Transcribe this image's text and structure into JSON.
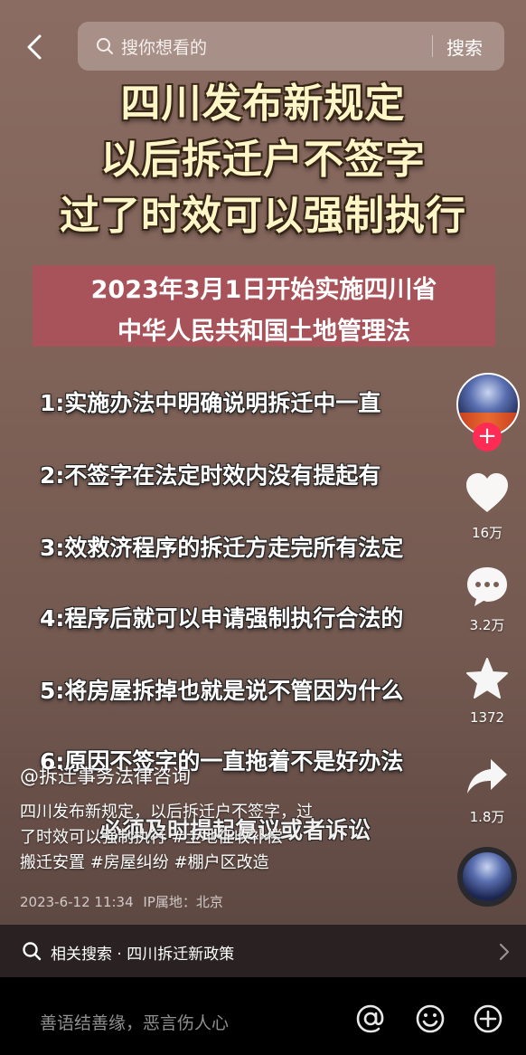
{
  "search": {
    "placeholder": "搜你想看的",
    "submit_label": "搜索"
  },
  "video": {
    "headline": [
      "四川发布新规定",
      "以后拆迁户不签字",
      "过了时效可以强制执行"
    ],
    "banner": [
      "2023年3月1日开始实施四川省",
      "中华人民共和国土地管理法"
    ],
    "items": [
      "1:实施办法中明确说明拆迁中一直",
      "2:不签字在法定时效内没有提起有",
      "3:效救济程序的拆迁方走完所有法定",
      "4:程序后就可以申请强制执行合法的",
      "5:将房屋拆掉也就是说不管因为什么",
      "6:原因不签字的一直拖着不是好办法"
    ],
    "overlay_text": "必须及时提起复议或者诉讼"
  },
  "actions": {
    "likes": "16万",
    "comments": "3.2万",
    "favorites": "1372",
    "shares": "1.8万",
    "follow_label": "+"
  },
  "post": {
    "author": "@拆迁事务法律咨询",
    "caption_lines": [
      "四川发布新规定，以后拆迁户不签字，过",
      "了时效可以强制执行 #土地征收补偿",
      "搬迁安置 #房屋纠纷 #棚户区改造"
    ],
    "date": "2023-6-12 11:34",
    "ip_label": "IP属地：北京"
  },
  "related_search": {
    "label": "相关搜索 · 四川拆迁新政策"
  },
  "comment_bar": {
    "placeholder": "善语结善缘，恶言伤人心"
  },
  "colors": {
    "accent": "#fe2c55",
    "headline": "#fff6c8",
    "banner": "#a8525a"
  }
}
